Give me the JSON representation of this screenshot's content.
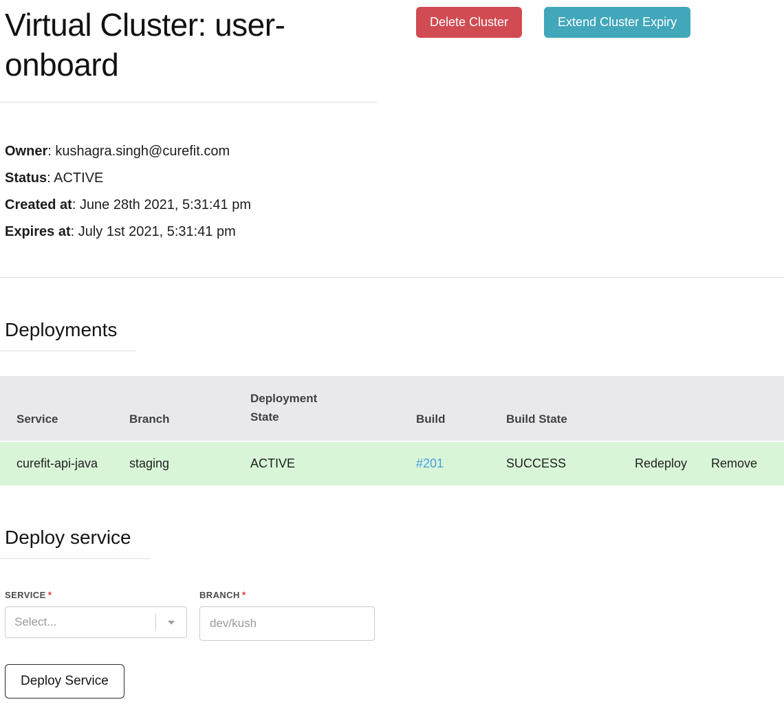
{
  "header": {
    "title": "Virtual Cluster: user-onboard",
    "delete_button": "Delete Cluster",
    "extend_button": "Extend Cluster Expiry"
  },
  "separator": ": ",
  "info": [
    {
      "label": "Owner",
      "value": "kushagra.singh@curefit.com"
    },
    {
      "label": "Status",
      "value": "ACTIVE"
    },
    {
      "label": "Created at",
      "value": "June 28th 2021, 5:31:41 pm"
    },
    {
      "label": "Expires at",
      "value": "July 1st 2021, 5:31:41 pm"
    }
  ],
  "deployments": {
    "heading": "Deployments",
    "table": {
      "headers": [
        "Service",
        "Branch",
        "Deployment State",
        "Build",
        "Build State",
        "",
        ""
      ],
      "rows": [
        {
          "service": "curefit-api-java",
          "branch": "staging",
          "deployment_state": "ACTIVE",
          "build": "#201",
          "build_state": "SUCCESS",
          "redeploy_label": "Redeploy",
          "remove_label": "Remove"
        }
      ]
    }
  },
  "deploy_form": {
    "heading": "Deploy service",
    "service_label": "SERVICE",
    "branch_label": "BRANCH",
    "required_marker": "*",
    "service_placeholder": "Select...",
    "branch_placeholder": "dev/kush",
    "submit_label": "Deploy Service"
  },
  "colors": {
    "danger": "#d14b52",
    "info": "#42a7ba",
    "row_success": "#d8f5d8",
    "link": "#4a9fe0",
    "required": "#dc4558"
  }
}
